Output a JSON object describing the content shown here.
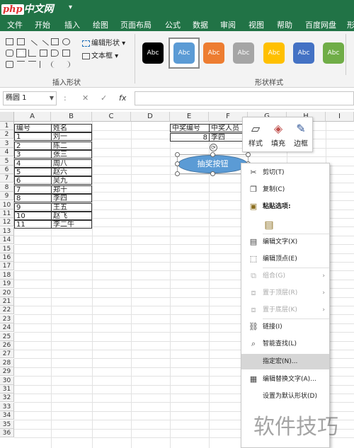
{
  "titlebar": {
    "logo_php": "php",
    "logo_text": "中文网",
    "qat_arrow": "▾"
  },
  "menu": {
    "tabs": [
      "文件",
      "开始",
      "插入",
      "绘图",
      "页面布局",
      "公式",
      "数据",
      "审阅",
      "视图",
      "帮助",
      "百度网盘",
      "形"
    ]
  },
  "ribbon": {
    "insert_shapes_label": "插入形状",
    "shape_styles_label": "形状样式",
    "edit_shape": "编辑形状",
    "text_box": "文本框",
    "style_buttons": [
      {
        "label": "Abc",
        "color": "#000000"
      },
      {
        "label": "Abc",
        "color": "#5b9bd5"
      },
      {
        "label": "Abc",
        "color": "#ed7d31"
      },
      {
        "label": "Abc",
        "color": "#a5a5a5"
      },
      {
        "label": "Abc",
        "color": "#ffc000"
      },
      {
        "label": "Abc",
        "color": "#4472c4"
      },
      {
        "label": "Abc",
        "color": "#70ad47"
      }
    ]
  },
  "formula_bar": {
    "name_box": "椭圆 1",
    "cancel": "✕",
    "enter": "✓",
    "fx": "fx",
    "colon": ":"
  },
  "sheet": {
    "columns": [
      "A",
      "B",
      "C",
      "D",
      "E",
      "F",
      "G",
      "H",
      "I"
    ],
    "rows": [
      "1",
      "2",
      "3",
      "4",
      "5",
      "6",
      "7",
      "8",
      "9",
      "10",
      "11",
      "12",
      "13",
      "14",
      "15",
      "16",
      "17",
      "18",
      "19",
      "20",
      "21",
      "22",
      "23",
      "24",
      "25",
      "26",
      "27",
      "28",
      "29",
      "30",
      "31",
      "32",
      "33",
      "34",
      "35",
      "36"
    ],
    "header_a": "编号",
    "header_b": "姓名",
    "table": [
      [
        "1",
        "刘一"
      ],
      [
        "2",
        "陈二"
      ],
      [
        "3",
        "张三"
      ],
      [
        "4",
        "周八"
      ],
      [
        "5",
        "赵六"
      ],
      [
        "6",
        "吴九"
      ],
      [
        "7",
        "郑十"
      ],
      [
        "8",
        "李四"
      ],
      [
        "9",
        "王五"
      ],
      [
        "10",
        "赵飞"
      ],
      [
        "11",
        "李二牛"
      ]
    ],
    "e1": "中奖编号",
    "f1": "中奖人员",
    "e2": "8",
    "f2": "李四"
  },
  "shape": {
    "text": "抽奖按钮",
    "rotate_glyph": "⟳"
  },
  "mini_toolbar": {
    "style": "样式",
    "fill": "填充",
    "border": "边框"
  },
  "context_menu": {
    "cut": "剪切(T)",
    "copy": "复制(C)",
    "paste_options": "粘贴选项:",
    "edit_text": "编辑文字(X)",
    "edit_points": "编辑顶点(E)",
    "group": "组合(G)",
    "bring_front": "置于顶层(R)",
    "send_back": "置于底层(K)",
    "link": "链接(I)",
    "smart_lookup": "智能查找(L)",
    "assign_macro": "指定宏(N)...",
    "edit_alt_text": "编辑替换文字(A)...",
    "set_default": "设置为默认形状(D)"
  },
  "watermark": "软件技巧"
}
